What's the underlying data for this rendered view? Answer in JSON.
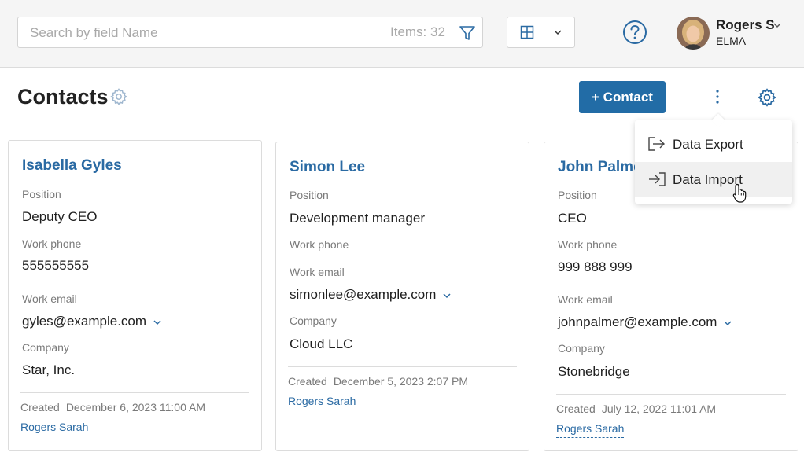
{
  "search": {
    "placeholder": "Search by field Name",
    "value": "",
    "items_count": "Items: 32"
  },
  "user": {
    "name": "Rogers S",
    "org": "ELMA"
  },
  "page": {
    "title": "Contacts",
    "add_button": "+ Contact"
  },
  "menu": {
    "items": [
      {
        "label": "Data Export"
      },
      {
        "label": "Data Import"
      }
    ]
  },
  "labels": {
    "position": "Position",
    "work_phone": "Work phone",
    "work_email": "Work email",
    "company": "Company",
    "created": "Created"
  },
  "contacts": [
    {
      "name": "Isabella Gyles",
      "position": "Deputy CEO",
      "phone": "555555555",
      "email": "gyles@example.com",
      "company": "Star, Inc.",
      "created": "December 6, 2023 11:00 AM",
      "author": "Rogers Sarah"
    },
    {
      "name": "Simon Lee",
      "position": "Development manager",
      "phone": "",
      "email": "simonlee@example.com",
      "company": "Cloud LLC",
      "created": "December 5, 2023 2:07 PM",
      "author": "Rogers Sarah"
    },
    {
      "name": "John Palme",
      "position": "CEO",
      "phone": "999 888 999",
      "email": "johnpalmer@example.com",
      "company": "Stonebridge",
      "created": "July 12, 2022 11:01 AM",
      "author": "Rogers Sarah"
    }
  ],
  "colors": {
    "accent": "#226ca6",
    "link": "#2a6aa3",
    "topbar": "#f5f5f5"
  }
}
